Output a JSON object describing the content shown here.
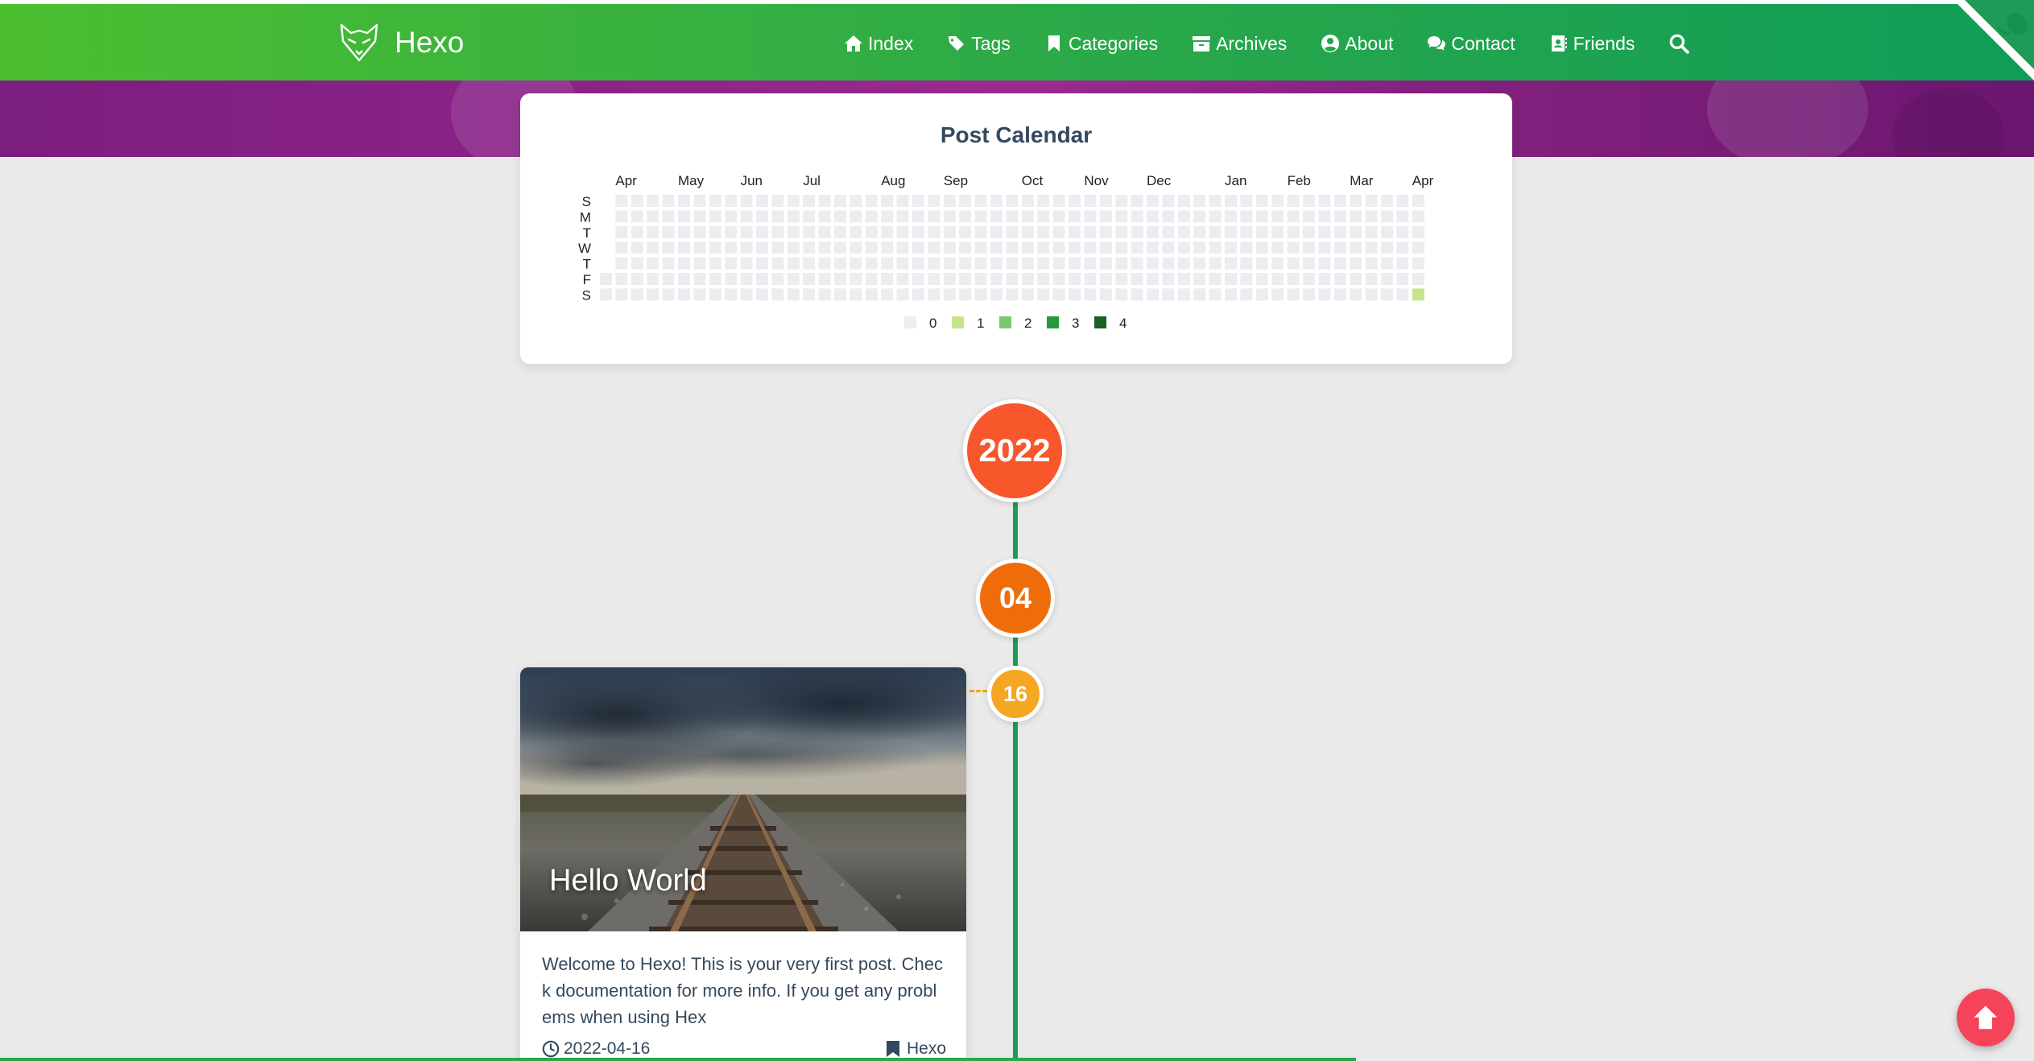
{
  "navbar": {
    "brand": "Hexo",
    "items": [
      {
        "label": "Index",
        "icon": "home-icon"
      },
      {
        "label": "Tags",
        "icon": "tags-icon"
      },
      {
        "label": "Categories",
        "icon": "bookmark-icon"
      },
      {
        "label": "Archives",
        "icon": "archive-icon"
      },
      {
        "label": "About",
        "icon": "user-circle-icon"
      },
      {
        "label": "Contact",
        "icon": "comments-icon"
      },
      {
        "label": "Friends",
        "icon": "address-book-icon"
      }
    ],
    "search_icon": "search-icon",
    "corner_icon": "github-octocat-icon"
  },
  "calendar": {
    "title": "Post Calendar",
    "months": [
      "Apr",
      "May",
      "Jun",
      "Jul",
      "Aug",
      "Sep",
      "Oct",
      "Nov",
      "Dec",
      "Jan",
      "Feb",
      "Mar",
      "Apr"
    ],
    "weekdays": [
      "S",
      "M",
      "T",
      "W",
      "T",
      "F",
      "S"
    ],
    "legend": [
      "0",
      "1",
      "2",
      "3",
      "4"
    ],
    "colors": [
      "#ebedf0",
      "#c6e48b",
      "#7bc96f",
      "#239a3b",
      "#196127"
    ],
    "weeks": 53,
    "active_days": [
      {
        "week": 52,
        "weekday": 6,
        "count": 1
      }
    ]
  },
  "timeline": {
    "year": "2022",
    "month": "04",
    "day": "16"
  },
  "post": {
    "title": "Hello World",
    "excerpt": "Welcome to Hexo! This is your very first post. Check documentation for more info. If you get any problems when using Hex",
    "date": "2022-04-16",
    "category": "Hexo"
  },
  "colors": {
    "accent": "#2aa84a",
    "year_badge": "#f8572b",
    "month_badge": "#ef6c0a",
    "day_badge": "#f5a623",
    "back_to_top": "#f5435a"
  }
}
